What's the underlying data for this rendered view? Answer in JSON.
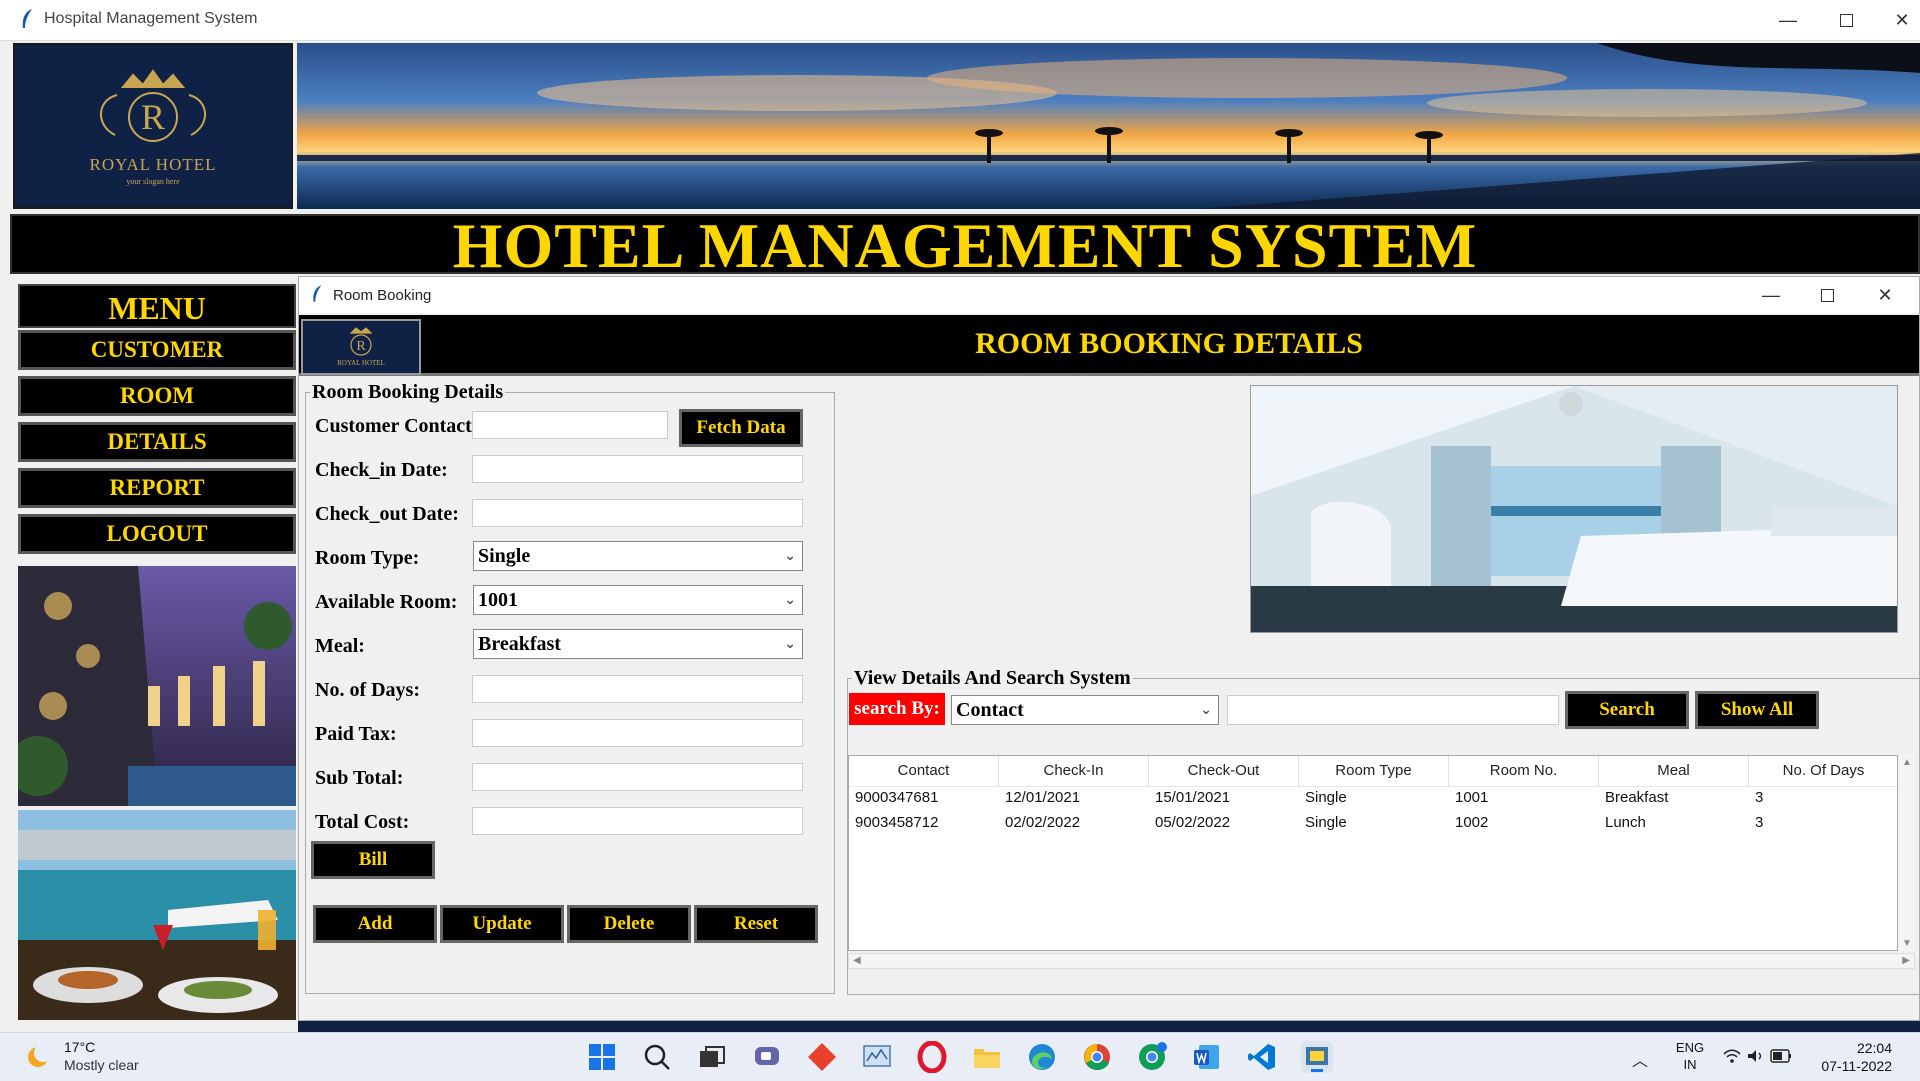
{
  "window": {
    "title": "Hospital Management System"
  },
  "header": {
    "logo_name": "ROYAL HOTEL",
    "logo_slogan": "your slogan here",
    "logo_letter": "R",
    "main_title": "HOTEL MANAGEMENT SYSTEM"
  },
  "menu": {
    "title": "MENU",
    "items": [
      "CUSTOMER",
      "ROOM",
      "DETAILS",
      "REPORT",
      "LOGOUT"
    ]
  },
  "sub_window": {
    "title": "Room Booking",
    "header_title": "ROOM BOOKING DETAILS",
    "logo_name": "ROYAL HOTEL",
    "logo_letter": "R"
  },
  "form": {
    "legend": "Room Booking Details",
    "labels": {
      "contact": "Customer Contact",
      "checkin": "Check_in Date:",
      "checkout": "Check_out Date:",
      "room_type": "Room Type:",
      "available_room": "Available Room:",
      "meal": "Meal:",
      "days": "No. of Days:",
      "tax": "Paid Tax:",
      "subtotal": "Sub Total:",
      "total": "Total Cost:"
    },
    "values": {
      "contact": "",
      "checkin": "",
      "checkout": "",
      "room_type": "Single",
      "available_room": "1001",
      "meal": "Breakfast",
      "days": "",
      "tax": "",
      "subtotal": "",
      "total": ""
    },
    "buttons": {
      "fetch": "Fetch Data",
      "bill": "Bill",
      "add": "Add",
      "update": "Update",
      "delete": "Delete",
      "reset": "Reset"
    }
  },
  "search": {
    "legend": "View Details And Search System",
    "by_label": "search By:",
    "by_value": "Contact",
    "query": "",
    "search_btn": "Search",
    "show_all_btn": "Show All"
  },
  "table": {
    "columns": [
      "Contact",
      "Check-In",
      "Check-Out",
      "Room Type",
      "Room No.",
      "Meal",
      "No. Of Days"
    ],
    "rows": [
      [
        "9000347681",
        "12/01/2021",
        "15/01/2021",
        "Single",
        "1001",
        "Breakfast",
        "3"
      ],
      [
        "9003458712",
        "02/02/2022",
        "05/02/2022",
        "Single",
        "1002",
        "Lunch",
        "3"
      ]
    ]
  },
  "taskbar": {
    "weather_temp": "17°C",
    "weather_desc": "Mostly clear",
    "lang1": "ENG",
    "lang2": "IN",
    "time": "22:04",
    "date": "07-11-2022"
  },
  "colors": {
    "accent_gold": "#ffd700",
    "search_label_bg": "#ff0000"
  }
}
